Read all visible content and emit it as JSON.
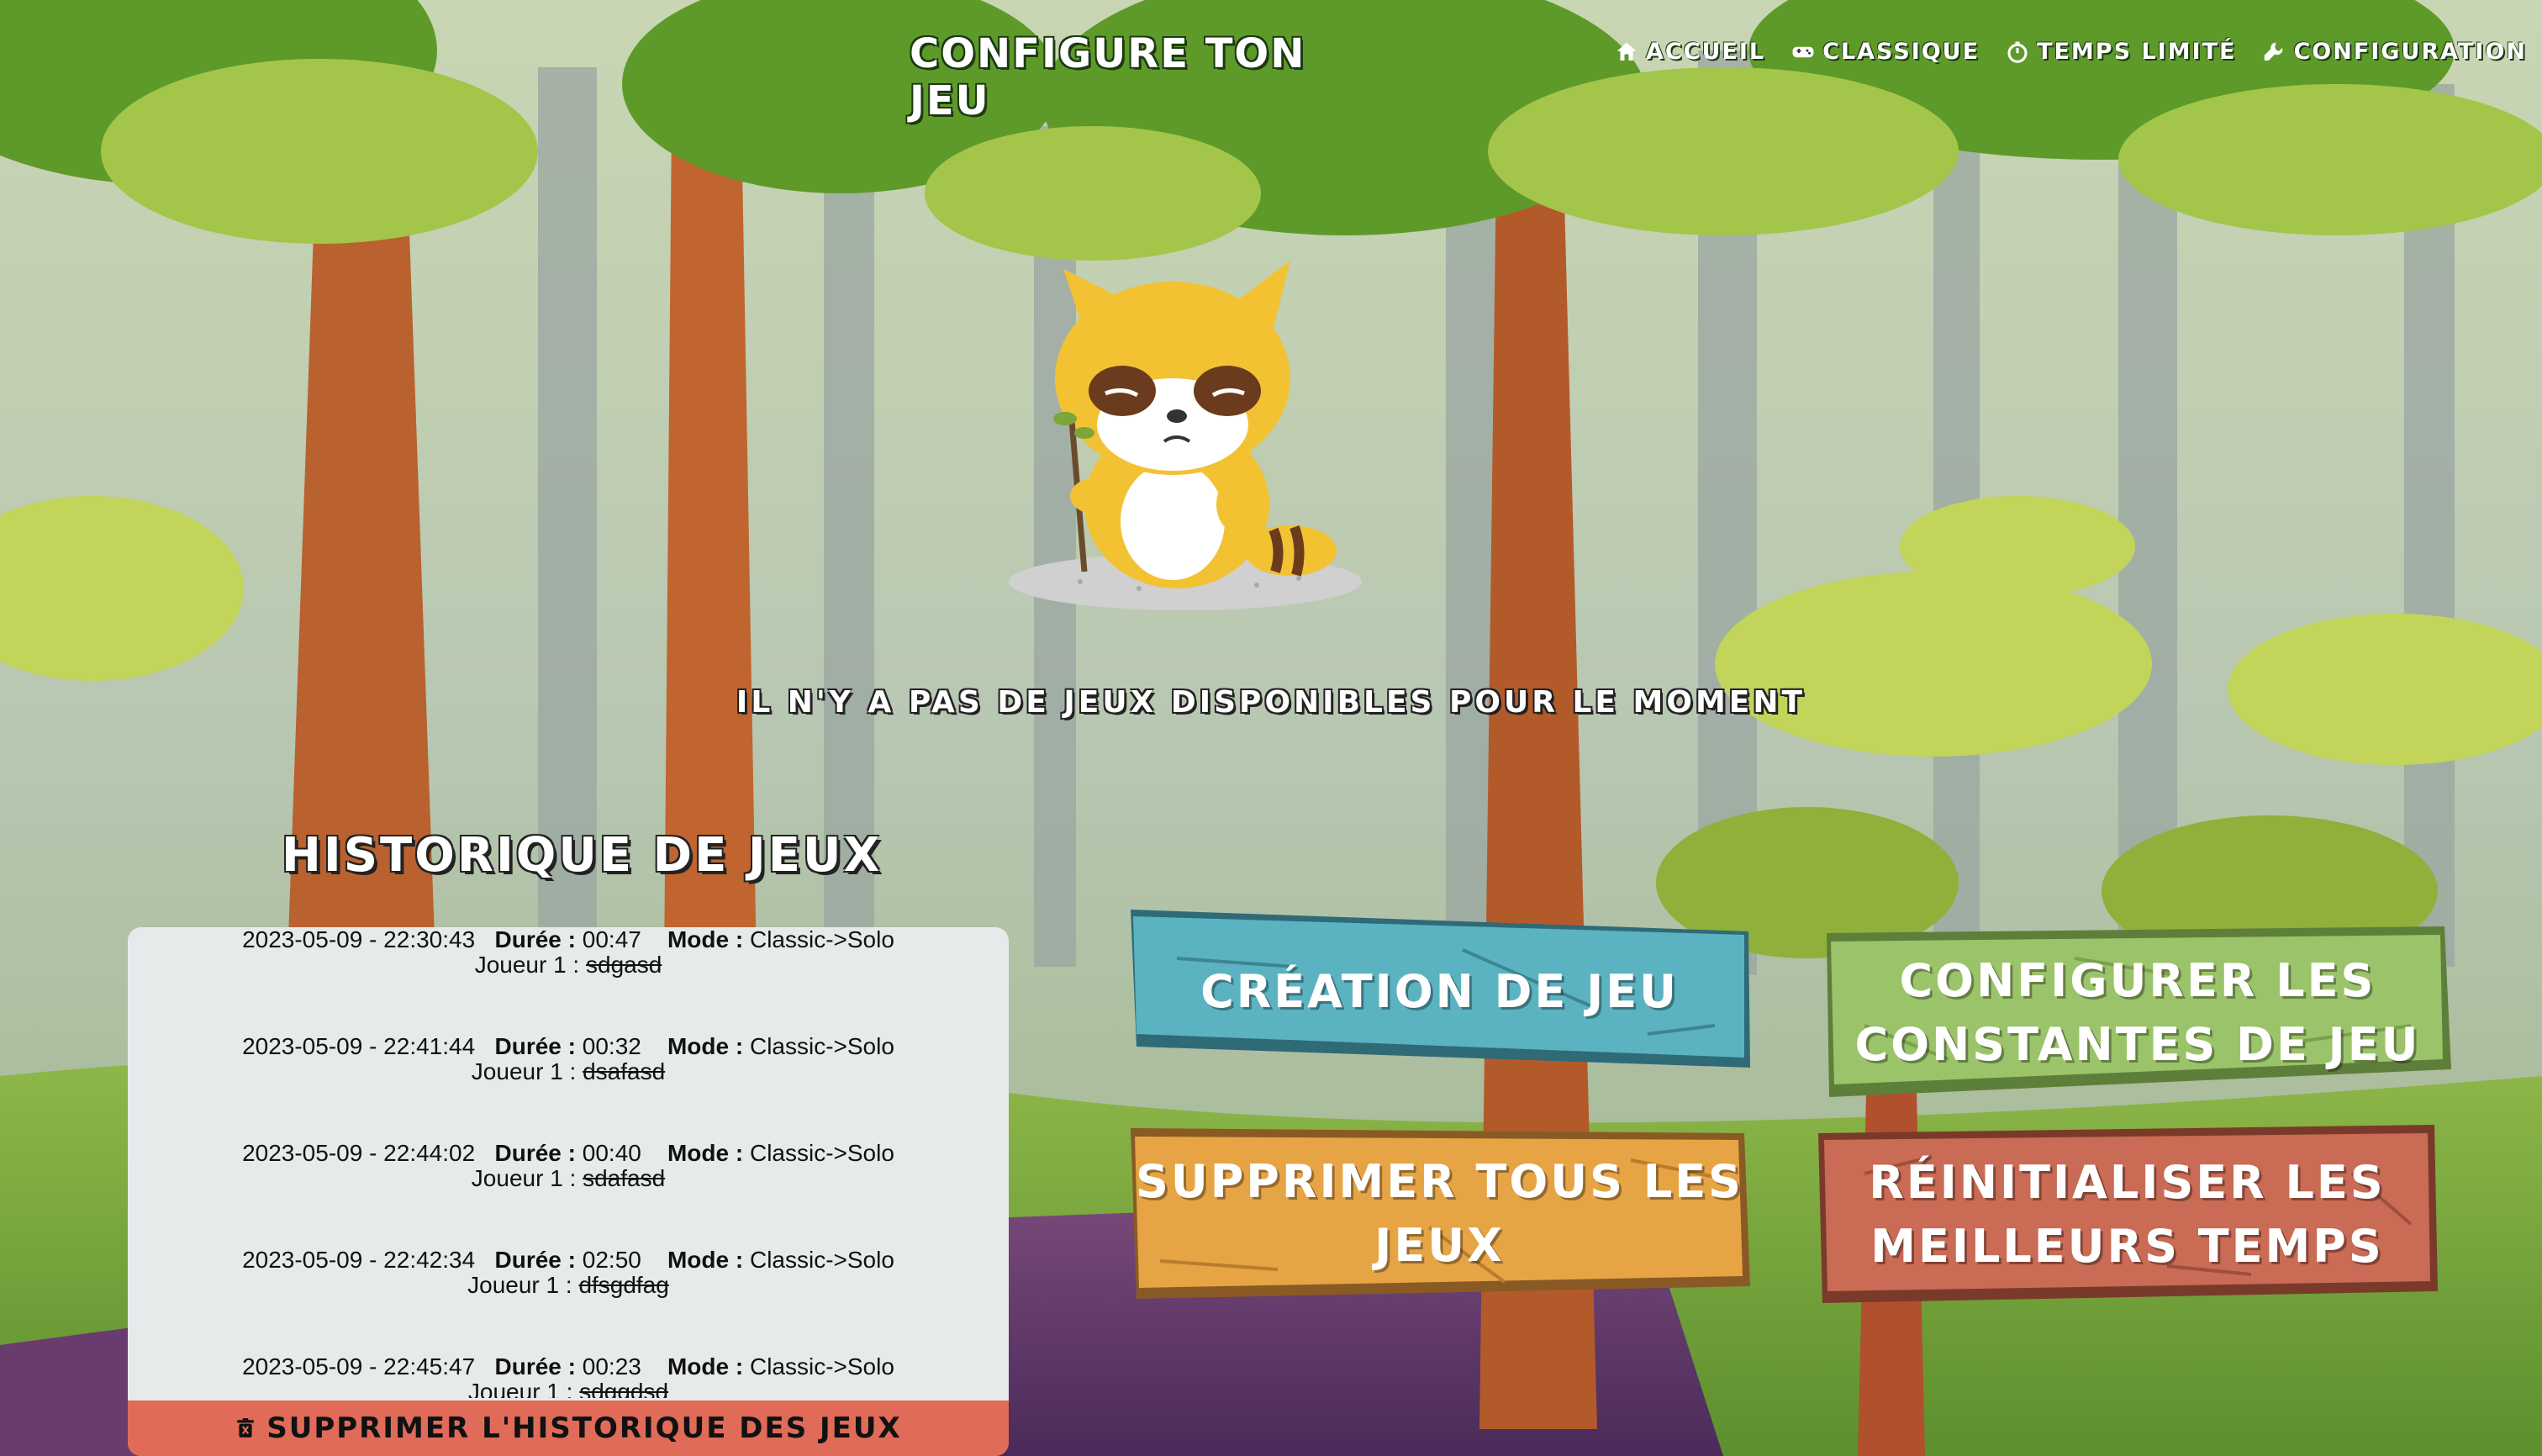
{
  "header": {
    "title": "CONFIGURE TON JEU",
    "nav": [
      {
        "label": "ACCUEIL",
        "icon": "home-icon"
      },
      {
        "label": "CLASSIQUE",
        "icon": "gamepad-icon"
      },
      {
        "label": "TEMPS LIMITÉ",
        "icon": "stopwatch-icon"
      },
      {
        "label": "CONFIGURATION",
        "icon": "wrench-icon"
      }
    ]
  },
  "main": {
    "empty_message": "IL N'Y A PAS DE JEUX DISPONIBLES POUR LE MOMENT",
    "mascot_icon": "sad-raccoon-illustration"
  },
  "history": {
    "title": "HISTORIQUE DE JEUX",
    "duration_label": "Durée :",
    "mode_label": "Mode :",
    "player_label": "Joueur 1 :",
    "entries": [
      {
        "date": "2023-05-09 - 22:30:43",
        "duration": "00:47",
        "mode": "Classic->Solo",
        "player": "sdgasd"
      },
      {
        "date": "2023-05-09 - 22:41:44",
        "duration": "00:32",
        "mode": "Classic->Solo",
        "player": "dsafasd"
      },
      {
        "date": "2023-05-09 - 22:44:02",
        "duration": "00:40",
        "mode": "Classic->Solo",
        "player": "sdafasd"
      },
      {
        "date": "2023-05-09 - 22:42:34",
        "duration": "02:50",
        "mode": "Classic->Solo",
        "player": "dfsgdfag"
      },
      {
        "date": "2023-05-09 - 22:45:47",
        "duration": "00:23",
        "mode": "Classic->Solo",
        "player": "sdggdsd"
      }
    ],
    "delete_label": "SUPPRIMER L'HISTORIQUE DES JEUX",
    "delete_icon": "trash-icon"
  },
  "actions": {
    "create_line1": "CRÉATION DE JEU",
    "constants_line1": "CONFIGURER LES",
    "constants_line2": "CONSTANTES DE JEU",
    "delete_all_line1": "SUPPRIMER TOUS LES",
    "delete_all_line2": "JEUX",
    "reset_line1": "RÉINITIALISER LES",
    "reset_line2": "MEILLEURS TEMPS"
  },
  "colors": {
    "create": "#5bb3c1",
    "constants": "#9bc36a",
    "delete_all": "#e6a445",
    "reset": "#c96b55",
    "history_delete": "#e06b59"
  }
}
